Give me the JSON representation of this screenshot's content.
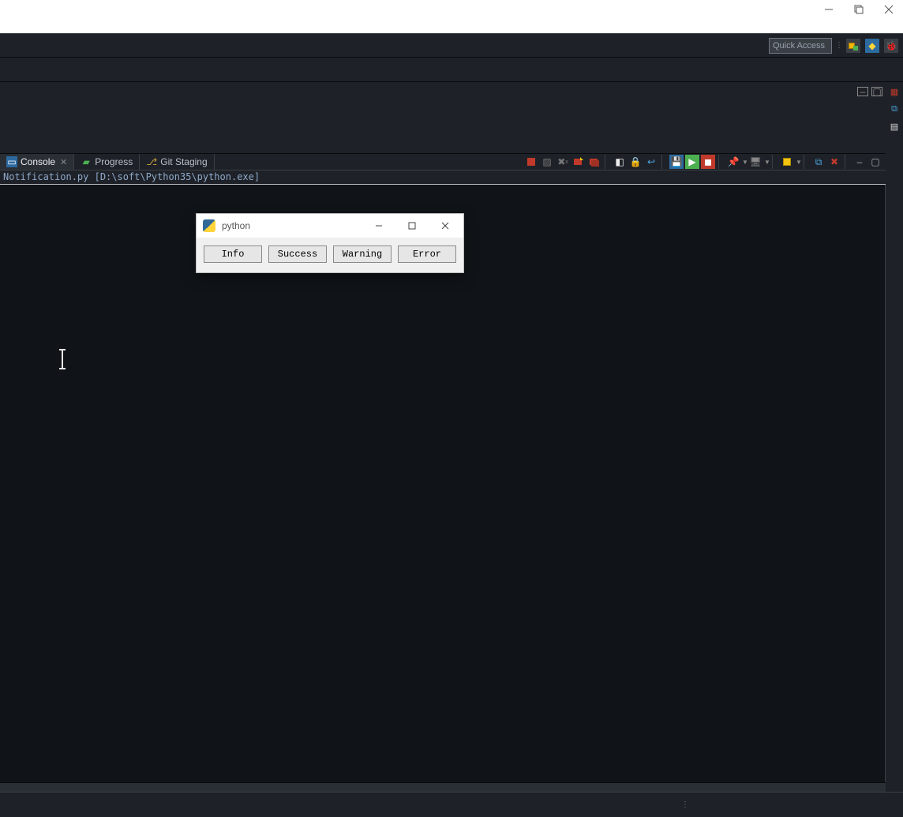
{
  "toolbar": {
    "quick_access_placeholder": "Quick Access"
  },
  "tabs": {
    "console": "Console",
    "progress": "Progress",
    "git_staging": "Git Staging"
  },
  "console": {
    "path_line": "Notification.py [D:\\soft\\Python35\\python.exe]"
  },
  "python_window": {
    "title": "python",
    "buttons": {
      "info": "Info",
      "success": "Success",
      "warning": "Warning",
      "error": "Error"
    }
  }
}
